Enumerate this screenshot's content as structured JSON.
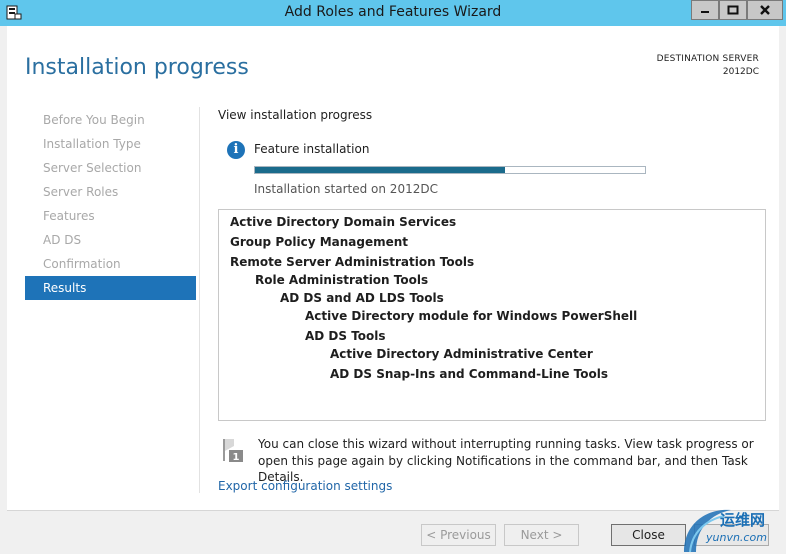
{
  "window": {
    "title": "Add Roles and Features Wizard",
    "controls": [
      "minimize-icon",
      "maximize-icon",
      "close-icon"
    ]
  },
  "header": {
    "page_title": "Installation progress",
    "destination_label": "DESTINATION SERVER",
    "destination_server": "2012DC"
  },
  "nav": {
    "items": [
      {
        "label": "Before You Begin",
        "active": false
      },
      {
        "label": "Installation Type",
        "active": false
      },
      {
        "label": "Server Selection",
        "active": false
      },
      {
        "label": "Server Roles",
        "active": false
      },
      {
        "label": "Features",
        "active": false
      },
      {
        "label": "AD DS",
        "active": false
      },
      {
        "label": "Confirmation",
        "active": false
      },
      {
        "label": "Results",
        "active": true
      }
    ]
  },
  "main": {
    "section_label": "View installation progress",
    "status_icon": "info-icon",
    "status_label": "Feature installation",
    "progress_percent": 64,
    "started_text": "Installation started on 2012DC",
    "features": [
      {
        "label": "Active Directory Domain Services",
        "level": 0
      },
      {
        "label": "Group Policy Management",
        "level": 0
      },
      {
        "label": "Remote Server Administration Tools",
        "level": 0
      },
      {
        "label": "Role Administration Tools",
        "level": 1
      },
      {
        "label": "AD DS and AD LDS Tools",
        "level": 2
      },
      {
        "label": "Active Directory module for Windows PowerShell",
        "level": 3
      },
      {
        "label": "AD DS Tools",
        "level": 3
      },
      {
        "label": "Active Directory Administrative Center",
        "level": 4
      },
      {
        "label": "AD DS Snap-Ins and Command-Line Tools",
        "level": 4
      }
    ],
    "note": "You can close this wizard without interrupting running tasks. View task progress or open this page again by clicking Notifications in the command bar, and then Task Details.",
    "export_link": "Export configuration settings"
  },
  "footer": {
    "previous_label": "< Previous",
    "next_label": "Next >",
    "close_label": "Close"
  },
  "watermark": {
    "cn": "运维网",
    "en": "yunvn.com"
  },
  "colors": {
    "titlebar": "#5fc6ec",
    "accent": "#1e73b8",
    "title_blue": "#2a6fa0",
    "progress_fill": "#1b6b8c",
    "link": "#2166a8"
  }
}
